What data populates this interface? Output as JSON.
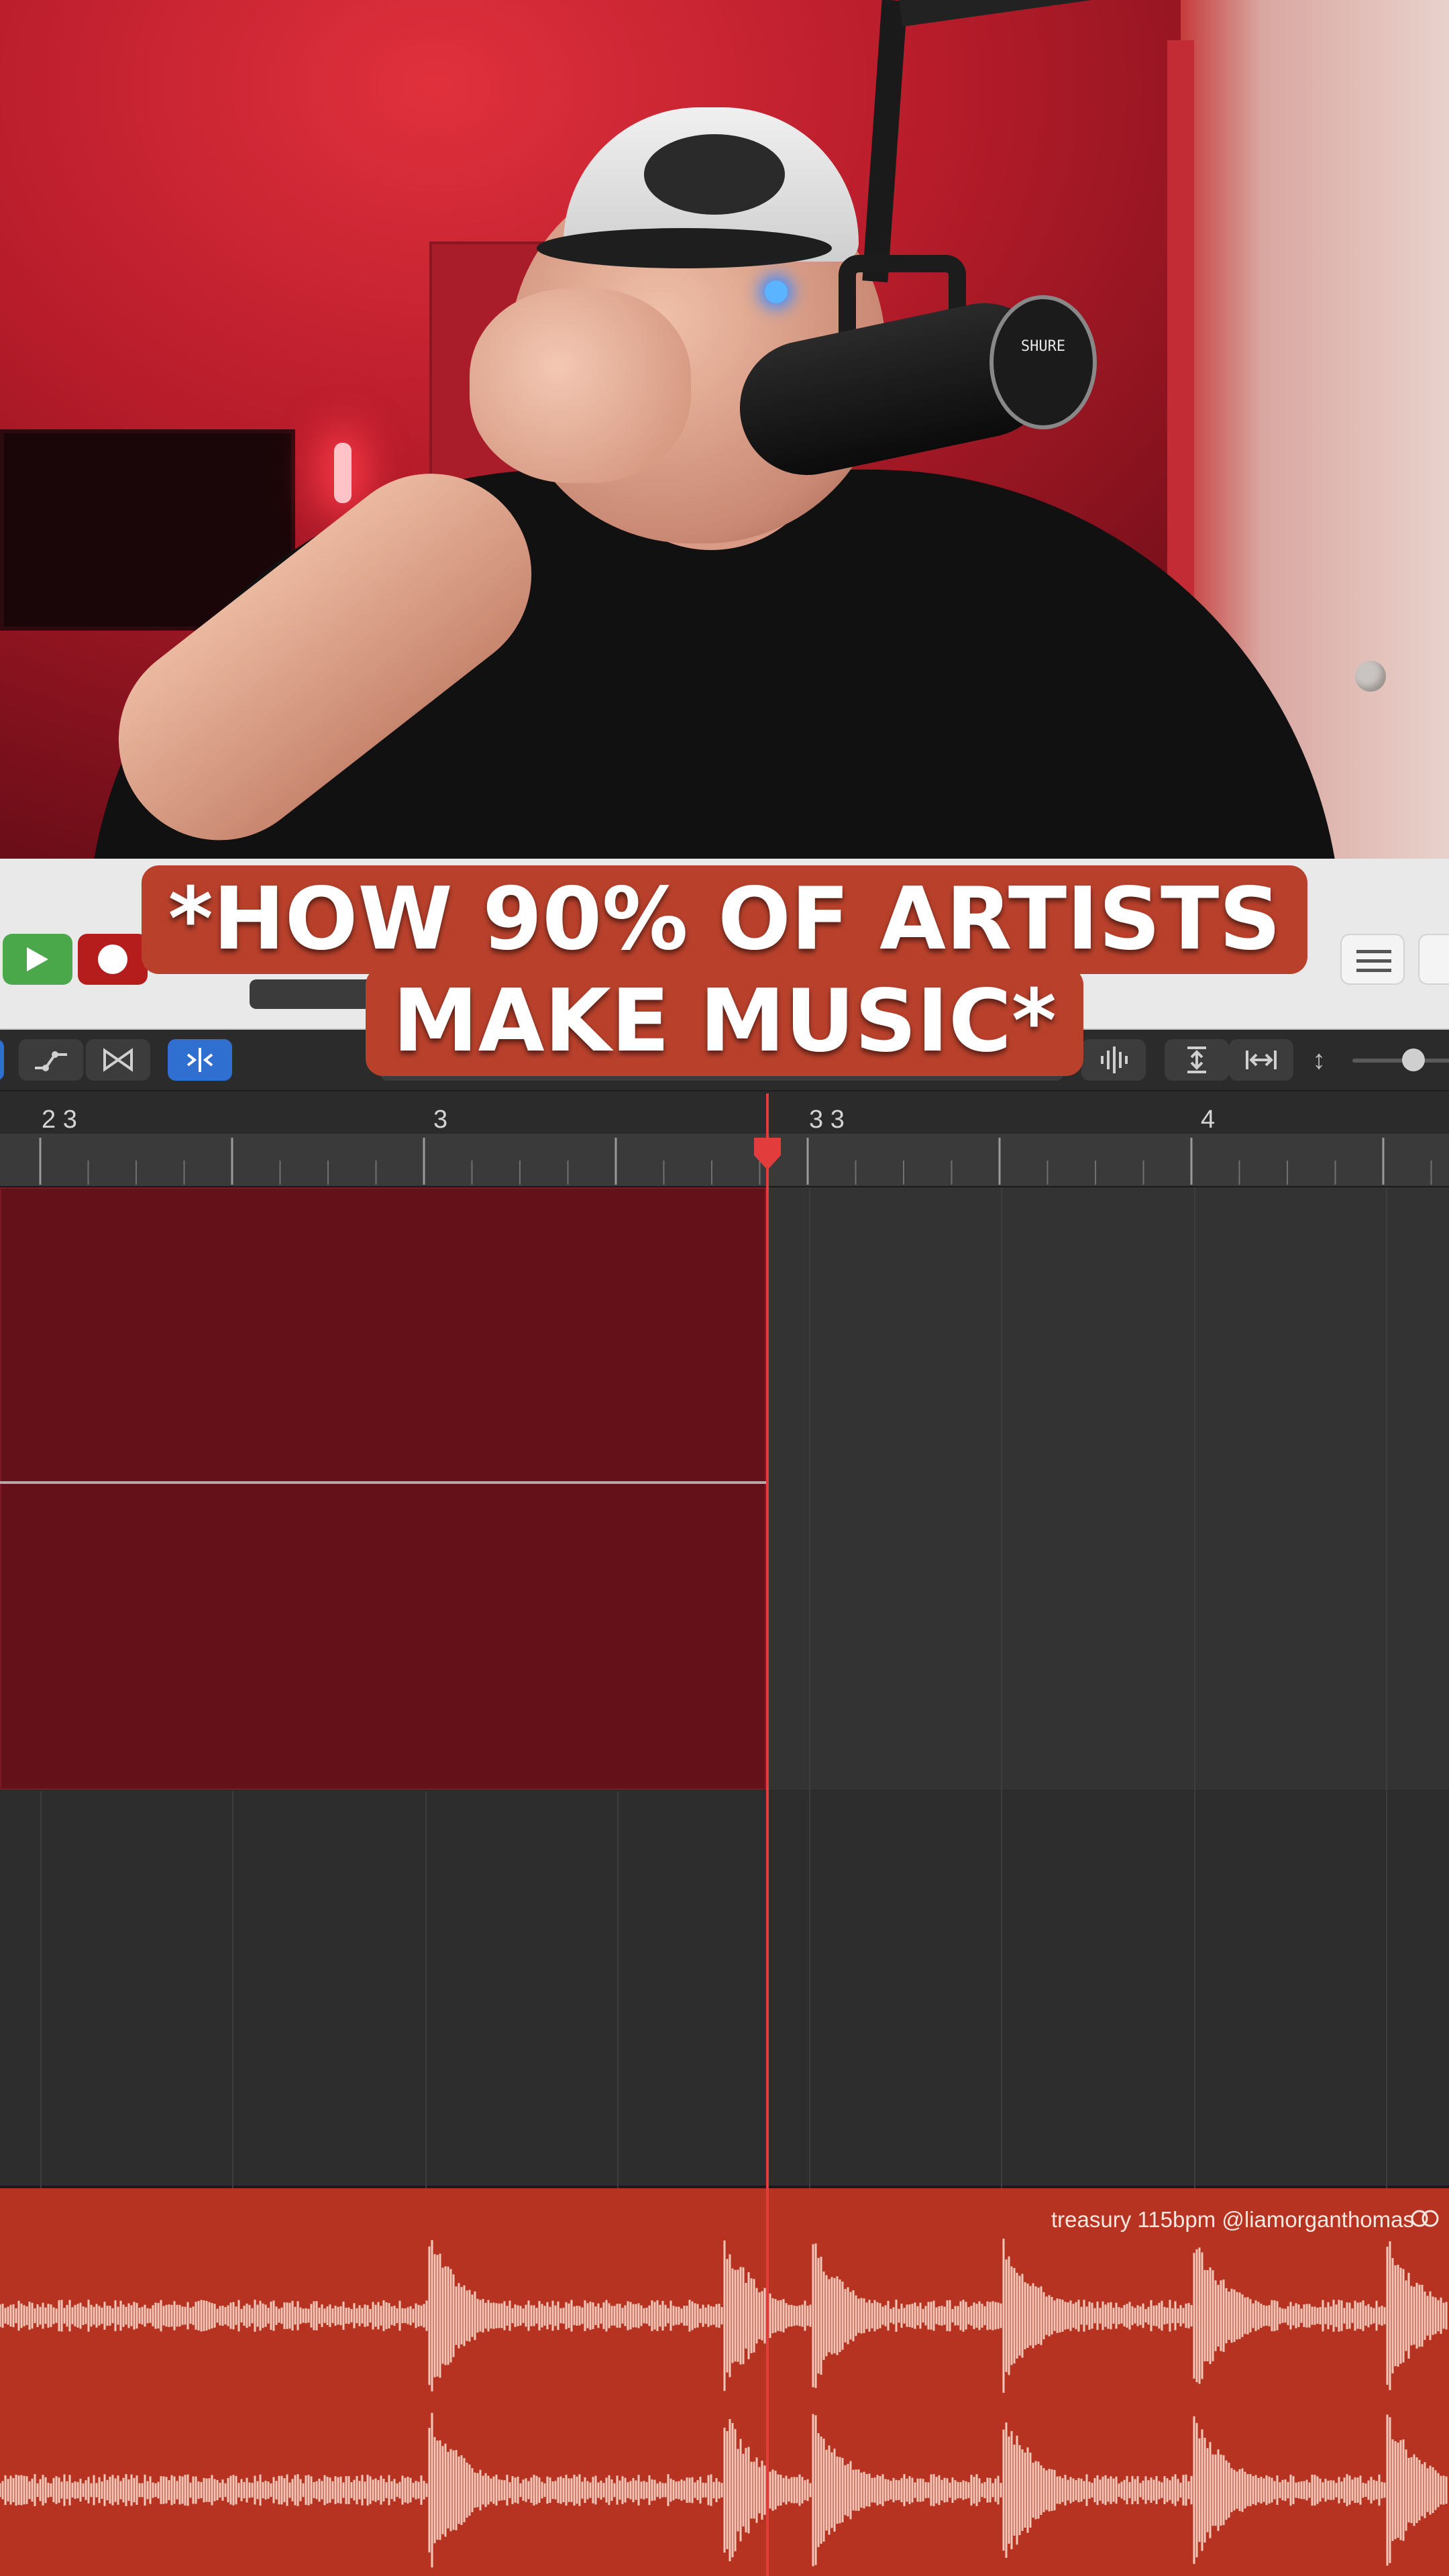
{
  "caption": {
    "line1": "*HOW 90% OF ARTISTS",
    "line2": "MAKE MUSIC*"
  },
  "ruler": {
    "bar_labels": [
      "2 3",
      "3",
      "3 3",
      "4"
    ]
  },
  "audio_region": {
    "name": "treasury 115bpm @liamorganthomas",
    "loop_icon": "loop-icon"
  },
  "mic_logo": "SHURE",
  "colors": {
    "region_red": "#65111a",
    "audio_region": "#b73321",
    "playhead": "#e33c3c",
    "play_green": "#4aa84a",
    "record_red": "#b51d1d",
    "caption_bg": "#b9412c"
  },
  "icons": {
    "play": "play-icon",
    "record": "record-icon",
    "automation": "automation-icon",
    "flex": "flex-icon",
    "catch": "catch-playhead-icon",
    "waveform_zoom": "waveform-zoom-icon",
    "vertical_zoom": "vertical-zoom-icon",
    "horizontal_zoom": "horizontal-zoom-icon",
    "list": "list-icon"
  }
}
